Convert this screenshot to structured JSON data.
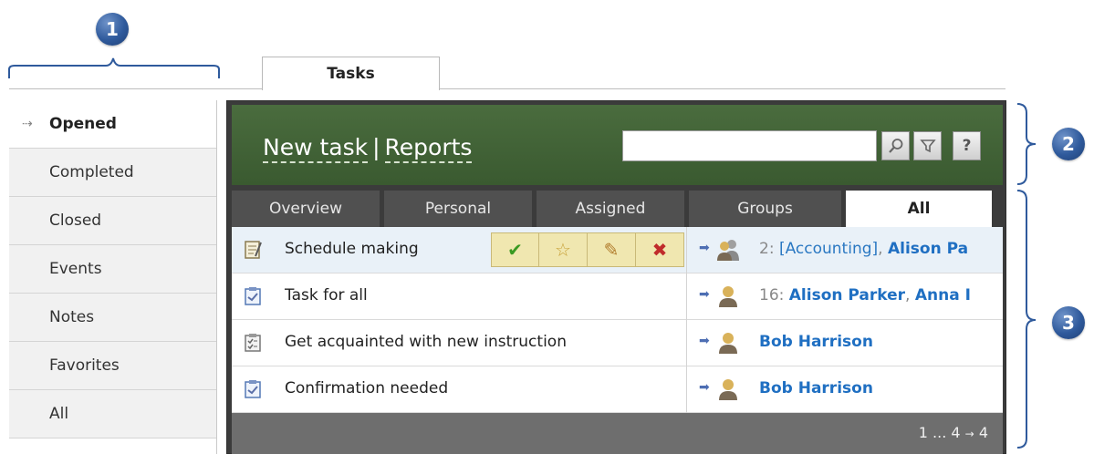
{
  "callouts": [
    "1",
    "2",
    "3"
  ],
  "main_tab": {
    "label": "Tasks"
  },
  "sidebar": {
    "items": [
      {
        "label": "Opened",
        "active": true
      },
      {
        "label": "Completed"
      },
      {
        "label": "Closed"
      },
      {
        "label": "Events"
      },
      {
        "label": "Notes"
      },
      {
        "label": "Favorites"
      },
      {
        "label": "All"
      }
    ]
  },
  "header": {
    "new_task": "New task",
    "separator": "|",
    "reports": "Reports",
    "search_value": "",
    "help_label": "?",
    "icons": [
      "search-icon",
      "filter-icon"
    ]
  },
  "subtabs": [
    "Overview",
    "Personal",
    "Assigned",
    "Groups",
    "All"
  ],
  "active_subtab": "All",
  "rows": [
    {
      "title": "Schedule making",
      "icon": "task-group-icon",
      "responsible_prefix": "2:",
      "group": "[Accounting]",
      "sep": ",",
      "users": "Alison Pa",
      "highlighted": true
    },
    {
      "title": "Task for all",
      "icon": "task-check-icon",
      "responsible_prefix": "16:",
      "users": "Alison Parker",
      "sep": ",",
      "users2": "Anna I"
    },
    {
      "title": "Get acquainted with new instruction",
      "icon": "task-list-icon",
      "users": "Bob Harrison"
    },
    {
      "title": "Confirmation needed",
      "icon": "task-check-icon",
      "users": "Bob Harrison"
    }
  ],
  "actions": [
    "complete-icon",
    "star-icon",
    "edit-icon",
    "delete-icon"
  ],
  "pager": {
    "first": "1",
    "ellipsis": "...",
    "last": "4",
    "arrow": "→",
    "next": "4"
  },
  "colors": {
    "header_green": "#3f5f35",
    "panel_dark": "#3b3b3b",
    "link_blue": "#1f6fc2",
    "action_bg": "#f0e7b0"
  }
}
